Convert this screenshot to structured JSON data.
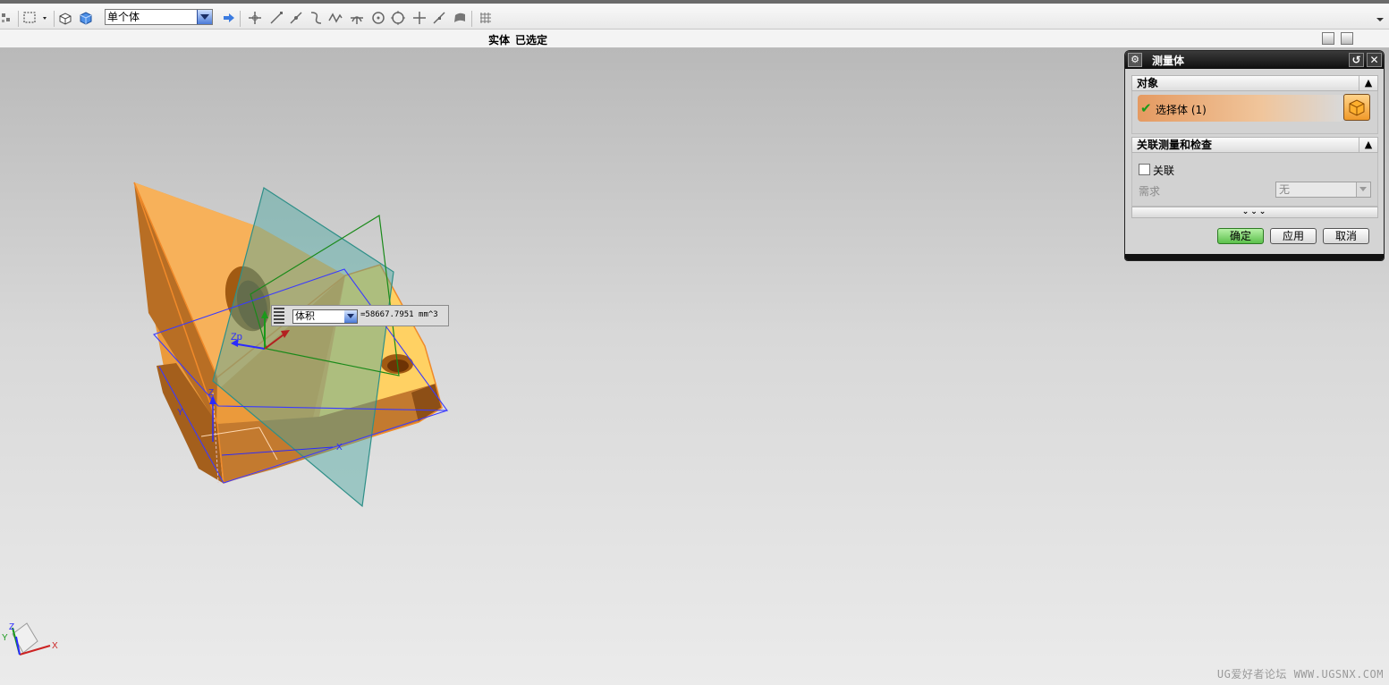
{
  "toolbar": {
    "selection_filter": "单个体",
    "icons": [
      "snap-settings-icon",
      "select-rect-icon",
      "render-wireframe-icon",
      "render-shaded-icon",
      "arrow-right-icon",
      "point-move-icon",
      "line-end-icon",
      "line-mid-icon",
      "curve-icon",
      "spline-icon",
      "intersect-icon",
      "circle-center-icon",
      "quadrant-icon",
      "point-on-icon",
      "tangent-icon",
      "surface-icon",
      "grid-icon"
    ]
  },
  "statusbar": {
    "part1": "实体",
    "part2": "已选定"
  },
  "measure_tag": {
    "type": "体积",
    "value": "=58667.7951 mm^3"
  },
  "scene_labels": {
    "zp": "Zp",
    "x": "X",
    "y": "Y",
    "z": "Z"
  },
  "triad": {
    "x": "X",
    "y": "Y",
    "z": "Z"
  },
  "dialog": {
    "title": "测量体",
    "group_object": {
      "header": "对象",
      "select_label": "选择体 (1)"
    },
    "group_assoc": {
      "header": "关联测量和检查",
      "assoc_label": "关联",
      "requirement_label": "需求",
      "requirement_value": "无"
    },
    "more_glyph": "⌄⌄⌄",
    "buttons": {
      "ok": "确定",
      "apply": "应用",
      "cancel": "取消"
    }
  },
  "watermark": "UG爱好者论坛 WWW.UGSNX.COM",
  "colors": {
    "solid_orange": "#f5a84a",
    "plane_teal": "#2f8f88",
    "wire_blue": "#3a3aff",
    "ok_green": "#5cc14c"
  }
}
